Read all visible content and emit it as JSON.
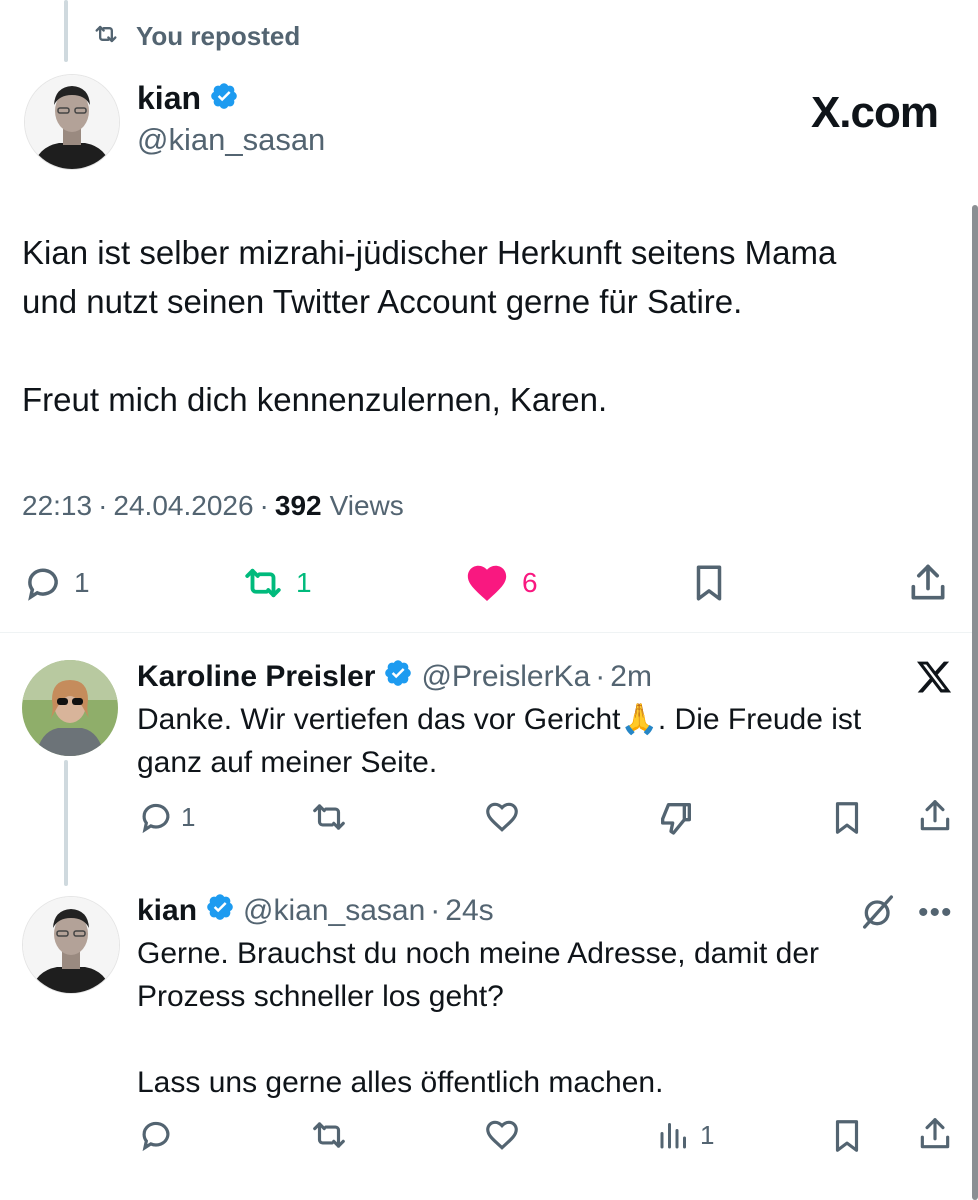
{
  "repost_banner": {
    "label": "You reposted"
  },
  "main_tweet": {
    "name": "kian",
    "handle": "@kian_sasan",
    "text": "Kian ist selber mizrahi-jüdischer Herkunft seitens Mama\nund nutzt seinen Twitter Account gerne für Satire.\n\nFreut mich dich kennenzulernen, Karen.",
    "time": "22:13",
    "date": "24.04.2026",
    "views_count": "392",
    "views_label": "Views",
    "reply_count": "1",
    "repost_count": "1",
    "like_count": "6"
  },
  "brand": {
    "logo_text": "X.com"
  },
  "reply_1": {
    "name": "Karoline Preisler",
    "handle": "@PreislerKa",
    "age": "2m",
    "text": "Danke. Wir vertiefen das vor Gericht🙏. Die Freude ist\nganz auf meiner Seite.",
    "reply_count": "1"
  },
  "reply_2": {
    "name": "kian",
    "handle": "@kian_sasan",
    "age": "24s",
    "text": "Gerne. Brauchst du noch meine Adresse, damit der\nProzess schneller los geht?\n\nLass uns gerne alles öffentlich machen.",
    "views_count": "1"
  },
  "colors": {
    "repost_green": "#00ba7c",
    "like_pink": "#f91880",
    "verified_blue": "#1d9bf0"
  }
}
